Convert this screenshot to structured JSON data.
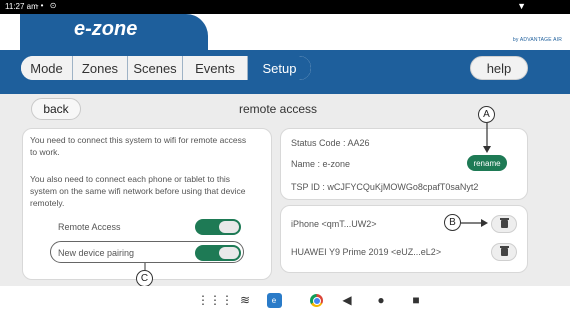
{
  "status_bar": {
    "time": "11:27 am",
    "icons": "-• ⊙",
    "wifi_icon": "wifi-icon"
  },
  "header": {
    "logo": "e-zone",
    "brand": "by ADVANTAGE AIR"
  },
  "nav": {
    "tabs": [
      {
        "label": "Mode",
        "active": false
      },
      {
        "label": "Zones",
        "active": false
      },
      {
        "label": "Scenes",
        "active": false
      },
      {
        "label": "Events",
        "active": false
      },
      {
        "label": "Setup",
        "active": true
      }
    ],
    "help_label": "help"
  },
  "page": {
    "back_label": "back",
    "title": "remote access"
  },
  "left_panel": {
    "para1": "You need to connect this system to wifi for remote access to work.",
    "para2": "You also need to connect each phone or tablet to this system on the same wifi network before using that device remotely.",
    "remote_access_label": "Remote Access",
    "remote_access_on": true,
    "new_pairing_label": "New device pairing",
    "new_pairing_on": true
  },
  "status_panel": {
    "status_code": "Status Code : AA26",
    "name": "Name : e-zone",
    "rename_label": "rename",
    "tsp_id": "TSP ID : wCJFYCQuKjMOWGo8cpafT0saNyt2"
  },
  "devices": [
    {
      "label": "iPhone <qmT...UW2>"
    },
    {
      "label": "HUAWEI Y9 Prime 2019 <eUZ...eL2>"
    }
  ],
  "callouts": {
    "a": "A",
    "b": "B",
    "c": "C"
  },
  "colors": {
    "brand_blue": "#1e5f9c",
    "toggle_green": "#1e7a55"
  },
  "bottom_bar": {
    "icons": [
      "apps-grid-icon",
      "wifi-icon",
      "ezone-app-icon",
      "chrome-icon",
      "back-icon",
      "home-icon",
      "recents-icon"
    ]
  }
}
